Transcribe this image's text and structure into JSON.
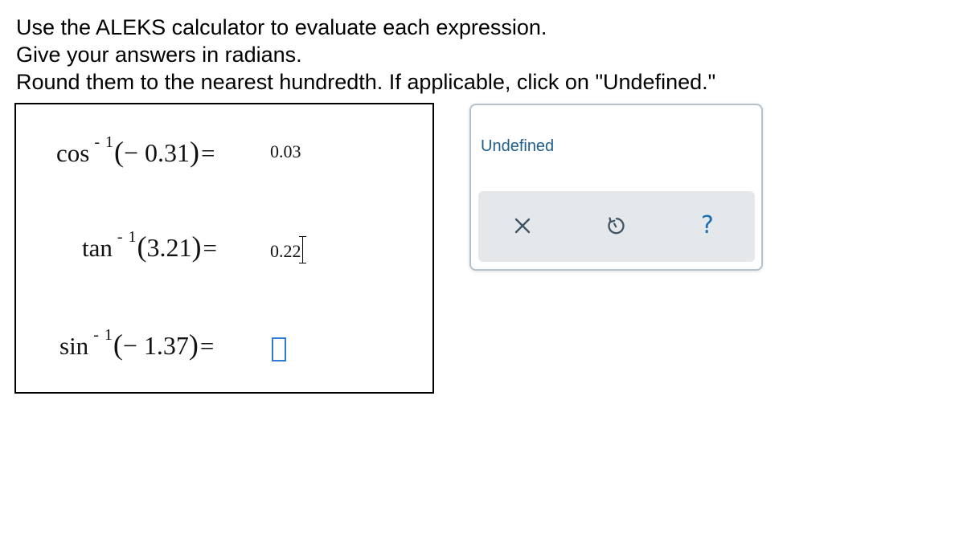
{
  "instructions": {
    "line1": "Use the ALEKS calculator to evaluate each expression.",
    "line2": "Give your answers in radians.",
    "line3": "Round them to the nearest hundredth. If applicable, click on \"Undefined.\""
  },
  "problems": [
    {
      "function": "cos",
      "superscript": "- 1",
      "open_paren": "(",
      "argument": "− 0.31",
      "close_paren": ")",
      "equals": "=",
      "answer": "0.03"
    },
    {
      "function": "tan",
      "superscript": "- 1",
      "open_paren": "(",
      "argument": "3.21",
      "close_paren": ")",
      "equals": "=",
      "answer": "0.22"
    },
    {
      "function": "sin",
      "superscript": "- 1",
      "open_paren": "(",
      "argument": "− 1.37",
      "close_paren": ")",
      "equals": "=",
      "answer": ""
    }
  ],
  "tools": {
    "undefined_label": "Undefined",
    "clear_icon": "close-icon",
    "undo_icon": "undo-icon",
    "help_icon": "help-icon",
    "help_glyph": "?"
  },
  "colors": {
    "accent_blue": "#2e7bd6",
    "link_blue": "#1f5f8b",
    "icon_gray": "#3f5565",
    "panel_gray": "#e4e8eb"
  }
}
